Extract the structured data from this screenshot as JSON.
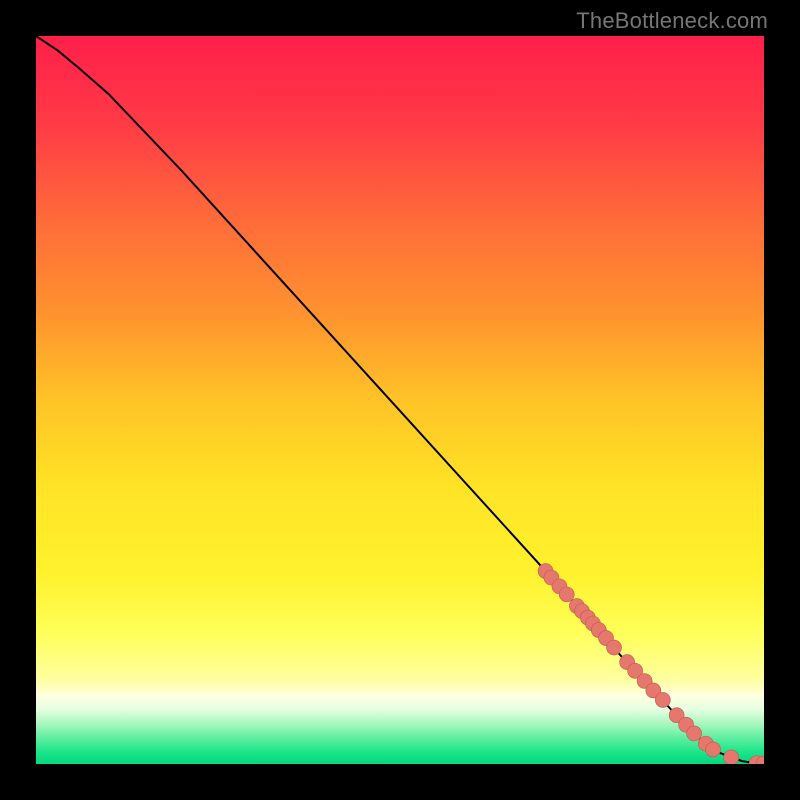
{
  "attribution": "TheBottleneck.com",
  "colors": {
    "black": "#000000",
    "curve": "#000000",
    "marker_fill": "#e5776d",
    "marker_stroke": "#c05a52",
    "gradient_stops": [
      {
        "offset": 0.0,
        "color": "#ff1f4a"
      },
      {
        "offset": 0.12,
        "color": "#ff3a46"
      },
      {
        "offset": 0.25,
        "color": "#ff6a3a"
      },
      {
        "offset": 0.38,
        "color": "#ff922f"
      },
      {
        "offset": 0.5,
        "color": "#ffc327"
      },
      {
        "offset": 0.62,
        "color": "#ffe326"
      },
      {
        "offset": 0.74,
        "color": "#fff22e"
      },
      {
        "offset": 0.82,
        "color": "#ffff5a"
      },
      {
        "offset": 0.885,
        "color": "#ffffa0"
      },
      {
        "offset": 0.905,
        "color": "#ffffe0"
      },
      {
        "offset": 0.925,
        "color": "#e4ffe0"
      },
      {
        "offset": 0.945,
        "color": "#a8f7bd"
      },
      {
        "offset": 0.965,
        "color": "#5ceea0"
      },
      {
        "offset": 0.985,
        "color": "#18e488"
      },
      {
        "offset": 1.0,
        "color": "#07d77e"
      }
    ]
  },
  "chart_data": {
    "type": "line",
    "title": "",
    "xlabel": "",
    "ylabel": "",
    "xlim": [
      0,
      100
    ],
    "ylim": [
      0,
      100
    ],
    "series": [
      {
        "name": "bottleneck-curve",
        "x": [
          0,
          3,
          6,
          10,
          20,
          30,
          40,
          50,
          60,
          70,
          78,
          82,
          86,
          89,
          91,
          92.5,
          94,
          95.5,
          97,
          98.5,
          100
        ],
        "y": [
          100,
          98,
          95.5,
          92,
          81.5,
          70.5,
          59.5,
          48.5,
          37.5,
          26.5,
          17.5,
          13.0,
          8.8,
          5.6,
          3.6,
          2.4,
          1.5,
          0.9,
          0.4,
          0.15,
          0.1
        ]
      }
    ],
    "markers": {
      "name": "highlight-points",
      "x": [
        70.0,
        70.8,
        71.9,
        72.9,
        74.3,
        75.0,
        75.8,
        76.5,
        77.3,
        78.3,
        79.4,
        81.2,
        82.3,
        83.6,
        84.8,
        86.1,
        88.0,
        89.3,
        90.4,
        92.0,
        93.0,
        95.5,
        99.0,
        100.0
      ],
      "y": [
        26.5,
        25.6,
        24.4,
        23.3,
        21.7,
        21.0,
        20.1,
        19.3,
        18.4,
        17.3,
        16.0,
        14.0,
        12.8,
        11.4,
        10.1,
        8.8,
        6.7,
        5.4,
        4.2,
        2.8,
        2.0,
        0.9,
        0.12,
        0.1
      ]
    }
  }
}
